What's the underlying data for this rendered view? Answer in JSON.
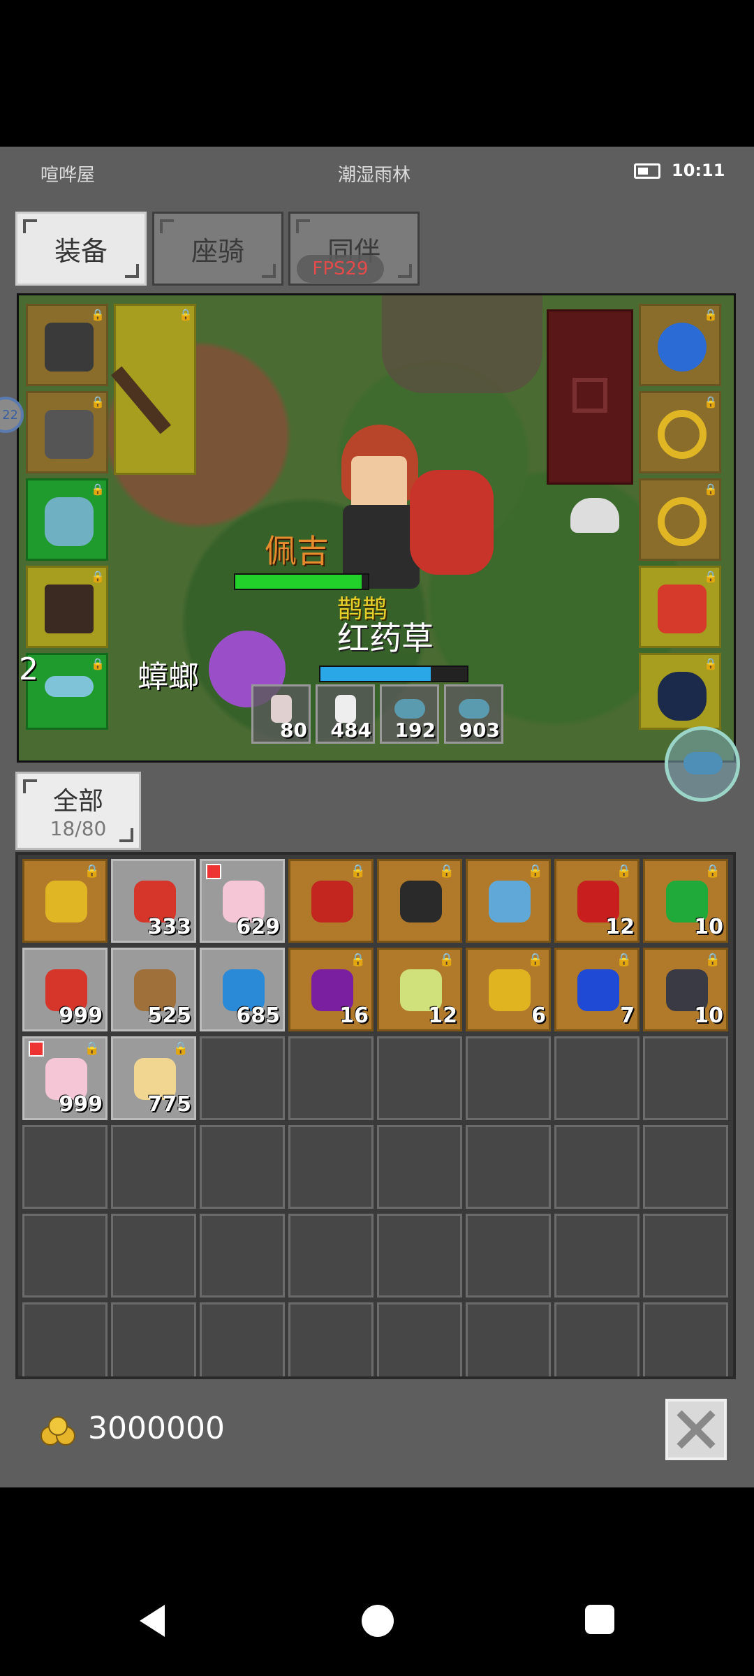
{
  "status": {
    "left": "喧哗屋",
    "center": "潮湿雨林",
    "time": "10:11"
  },
  "tabs": [
    {
      "label": "装备",
      "active": true
    },
    {
      "label": "座骑",
      "active": false
    },
    {
      "label": "同伴",
      "active": false
    }
  ],
  "fps": "FPS29",
  "scene": {
    "player_name": "佩吉",
    "pet_name": "鹊鹊",
    "target_name": "红药草",
    "side_text": "2",
    "enemy_text": "蟑螂",
    "edge_badge": "22",
    "hp_fraction": 0.95,
    "mp_fraction": 0.75,
    "potions": [
      {
        "icon": "red-potion-icon",
        "count": "80"
      },
      {
        "icon": "white-potion-icon",
        "count": "484"
      },
      {
        "icon": "blue-herb-icon",
        "count": "192"
      },
      {
        "icon": "blue-herb-icon",
        "count": "903"
      }
    ]
  },
  "filter": {
    "label": "全部",
    "count": "18/80"
  },
  "inventory": {
    "rows": [
      [
        {
          "icon": "golden-sword-icon",
          "count": "",
          "style": "gold",
          "lock": true,
          "new": false
        },
        {
          "icon": "red-feather-icon",
          "count": "333",
          "style": "grey",
          "lock": false,
          "new": false
        },
        {
          "icon": "cake-icon",
          "count": "629",
          "style": "grey",
          "lock": false,
          "new": true
        },
        {
          "icon": "red-blade-icon",
          "count": "",
          "style": "gold",
          "lock": true,
          "new": false
        },
        {
          "icon": "black-armor-icon",
          "count": "",
          "style": "gold",
          "lock": true,
          "new": false
        },
        {
          "icon": "blue-spear-icon",
          "count": "",
          "style": "gold",
          "lock": true,
          "new": false
        },
        {
          "icon": "red-gem-icon",
          "count": "12",
          "style": "gold",
          "lock": true,
          "new": false
        },
        {
          "icon": "green-gem-icon",
          "count": "10",
          "style": "gold",
          "lock": true,
          "new": false
        }
      ],
      [
        {
          "icon": "red-feather-icon",
          "count": "999",
          "style": "grey",
          "lock": false,
          "new": false
        },
        {
          "icon": "brown-nut-icon",
          "count": "525",
          "style": "grey",
          "lock": false,
          "new": false
        },
        {
          "icon": "blue-feather-icon",
          "count": "685",
          "style": "grey",
          "lock": false,
          "new": false
        },
        {
          "icon": "purple-gem-icon",
          "count": "16",
          "style": "gold",
          "lock": true,
          "new": false
        },
        {
          "icon": "pale-green-gem-icon",
          "count": "12",
          "style": "gold",
          "lock": true,
          "new": false
        },
        {
          "icon": "yellow-gem-icon",
          "count": "6",
          "style": "gold",
          "lock": true,
          "new": false
        },
        {
          "icon": "blue-gem-icon",
          "count": "7",
          "style": "gold",
          "lock": true,
          "new": false
        },
        {
          "icon": "black-gem-icon",
          "count": "10",
          "style": "gold",
          "lock": true,
          "new": false
        }
      ],
      [
        {
          "icon": "cake-icon",
          "count": "999",
          "style": "grey",
          "lock": true,
          "new": true
        },
        {
          "icon": "scroll-icon",
          "count": "775",
          "style": "grey",
          "lock": true,
          "new": false
        }
      ]
    ],
    "empty_visible_rows": 4
  },
  "gold": {
    "amount": "3000000"
  },
  "colors": {
    "panel": "#5e5e5e",
    "gold_slot": "#b07a2a",
    "hp": "#22d12a",
    "mp": "#2aa7e6"
  }
}
